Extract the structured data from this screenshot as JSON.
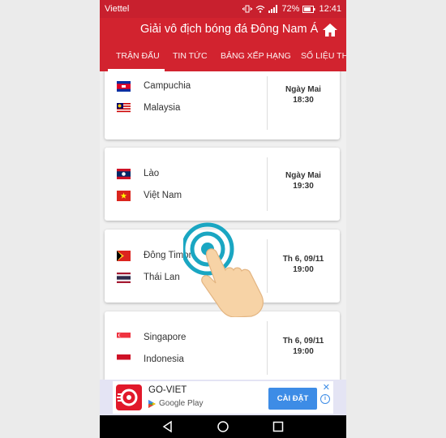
{
  "status": {
    "carrier": "Viettel",
    "battery": "72%",
    "time": "12:41"
  },
  "appbar": {
    "title": "Giải vô địch bóng đá Đông Nam Á",
    "home_icon": "home-icon"
  },
  "tabs": [
    {
      "label": "TRẬN ĐẤU",
      "active": true
    },
    {
      "label": "TIN TỨC",
      "active": false
    },
    {
      "label": "BẢNG XẾP HẠNG",
      "active": false
    },
    {
      "label": "SỐ LIỆU THỐ",
      "active": false
    }
  ],
  "matches": [
    {
      "team1": "Campuchia",
      "team2": "Malaysia",
      "day": "Ngày Mai",
      "time": "18:30"
    },
    {
      "team1": "Lào",
      "team2": "Việt Nam",
      "day": "Ngày Mai",
      "time": "19:30"
    },
    {
      "team1": "Đông Timor",
      "team2": "Thái Lan",
      "day": "Th 6, 09/11",
      "time": "19:00"
    },
    {
      "team1": "Singapore",
      "team2": "Indonesia",
      "day": "Th 6, 09/11",
      "time": "19:00"
    }
  ],
  "ad": {
    "app_name": "GO-VIET",
    "store": "Google Play",
    "button": "CÀI ĐẶT",
    "close": "✕",
    "info": "i"
  },
  "colors": {
    "primary": "#d2232f",
    "status_bar": "#c8202e",
    "ad_button": "#3d8ce6",
    "touch_ring": "#1aa6c2"
  }
}
